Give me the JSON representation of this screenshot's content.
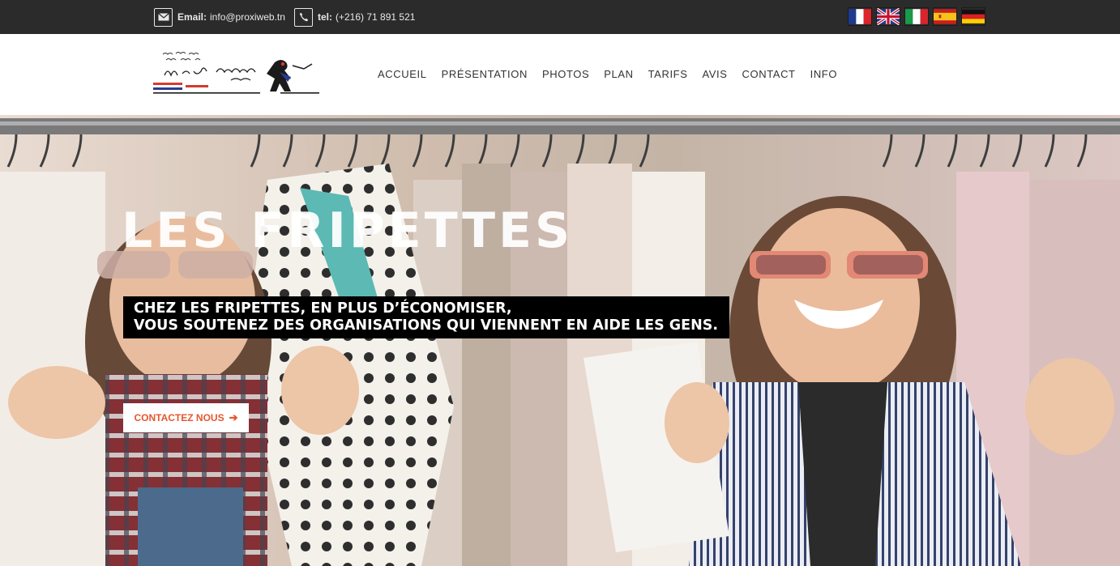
{
  "topbar": {
    "email_label": "Email:",
    "email_value": "info@proxiweb.tn",
    "email_icon": "envelope-icon",
    "tel_label": "tel:",
    "tel_value": "(+216) 71 891 521",
    "tel_icon": "phone-icon",
    "flags": [
      "flag-france",
      "flag-uk",
      "flag-italy",
      "flag-spain",
      "flag-germany"
    ]
  },
  "nav": {
    "items": [
      "ACCUEIL",
      "PRÉSENTATION",
      "PHOTOS",
      "PLAN",
      "TARIFS",
      "AVIS",
      "CONTACT",
      "INFO"
    ]
  },
  "hero": {
    "title": "LES FRIPETTES",
    "subtitle_line1": "CHEZ LES FRIPETTES, EN PLUS D’ÉCONOMISER,",
    "subtitle_line2": "VOUS SOUTENEZ DES ORGANISATIONS QUI VIENNENT EN AIDE LES GENS.",
    "cta_label": "CONTACTEZ NOUS",
    "cta_icon": "arrow-right-icon"
  },
  "colors": {
    "topbar_bg": "#2b2b2b",
    "accent": "#e4572e",
    "subtitle_bg": "#000000"
  }
}
